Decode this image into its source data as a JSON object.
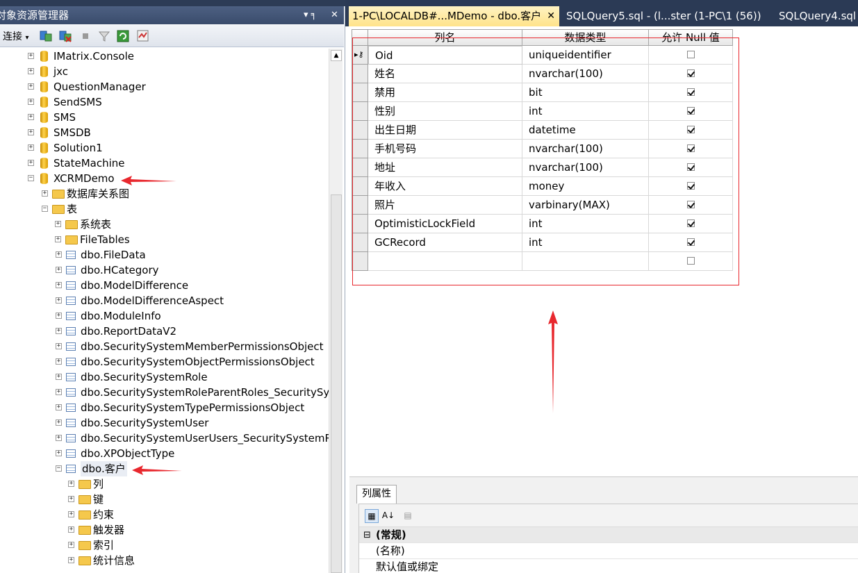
{
  "object_explorer": {
    "title": "对象资源管理器",
    "pin_glyph": "▾ ╕",
    "close_glyph": "✕",
    "connect_label": "连接",
    "connect_caret": "▾",
    "tree": [
      {
        "label": "IMatrix.Console",
        "kind": "database",
        "expander": "+"
      },
      {
        "label": "jxc",
        "kind": "database",
        "expander": "+"
      },
      {
        "label": "QuestionManager",
        "kind": "database",
        "expander": "+"
      },
      {
        "label": "SendSMS",
        "kind": "database",
        "expander": "+"
      },
      {
        "label": "SMS",
        "kind": "database",
        "expander": "+"
      },
      {
        "label": "SMSDB",
        "kind": "database",
        "expander": "+"
      },
      {
        "label": "Solution1",
        "kind": "database",
        "expander": "+"
      },
      {
        "label": "StateMachine",
        "kind": "database",
        "expander": "+"
      },
      {
        "label": "XCRMDemo",
        "kind": "database",
        "expander": "−"
      },
      {
        "label": "数据库关系图",
        "kind": "folder",
        "expander": "+"
      },
      {
        "label": "表",
        "kind": "folder",
        "expander": "−"
      },
      {
        "label": "系统表",
        "kind": "folder",
        "expander": "+"
      },
      {
        "label": "FileTables",
        "kind": "folder",
        "expander": "+"
      },
      {
        "label": "dbo.FileData",
        "kind": "table",
        "expander": "+"
      },
      {
        "label": "dbo.HCategory",
        "kind": "table",
        "expander": "+"
      },
      {
        "label": "dbo.ModelDifference",
        "kind": "table",
        "expander": "+"
      },
      {
        "label": "dbo.ModelDifferenceAspect",
        "kind": "table",
        "expander": "+"
      },
      {
        "label": "dbo.ModuleInfo",
        "kind": "table",
        "expander": "+"
      },
      {
        "label": "dbo.ReportDataV2",
        "kind": "table",
        "expander": "+"
      },
      {
        "label": "dbo.SecuritySystemMemberPermissionsObject",
        "kind": "table",
        "expander": "+"
      },
      {
        "label": "dbo.SecuritySystemObjectPermissionsObject",
        "kind": "table",
        "expander": "+"
      },
      {
        "label": "dbo.SecuritySystemRole",
        "kind": "table",
        "expander": "+"
      },
      {
        "label": "dbo.SecuritySystemRoleParentRoles_SecuritySys",
        "kind": "table",
        "expander": "+"
      },
      {
        "label": "dbo.SecuritySystemTypePermissionsObject",
        "kind": "table",
        "expander": "+"
      },
      {
        "label": "dbo.SecuritySystemUser",
        "kind": "table",
        "expander": "+"
      },
      {
        "label": "dbo.SecuritySystemUserUsers_SecuritySystemRo",
        "kind": "table",
        "expander": "+"
      },
      {
        "label": "dbo.XPObjectType",
        "kind": "table",
        "expander": "+"
      },
      {
        "label": "dbo.客户",
        "kind": "table",
        "expander": "−"
      },
      {
        "label": "列",
        "kind": "folder",
        "expander": "+"
      },
      {
        "label": "键",
        "kind": "folder",
        "expander": "+"
      },
      {
        "label": "约束",
        "kind": "folder",
        "expander": "+"
      },
      {
        "label": "触发器",
        "kind": "folder",
        "expander": "+"
      },
      {
        "label": "索引",
        "kind": "folder",
        "expander": "+"
      },
      {
        "label": "统计信息",
        "kind": "folder",
        "expander": "+"
      }
    ]
  },
  "tabs": [
    {
      "label": "1-PC\\LOCALDB#...MDemo - dbo.客户",
      "close": "✕"
    },
    {
      "label": "SQLQuery5.sql - (l...ster (1-PC\\1 (56))"
    },
    {
      "label": "SQLQuery4.sql -"
    }
  ],
  "designer": {
    "headers": {
      "name": "列名",
      "type": "数据类型",
      "null": "允许 Null 值"
    },
    "rows": [
      {
        "name": "Oid",
        "type": "uniqueidentifier",
        "allow_null": false,
        "key": true
      },
      {
        "name": "姓名",
        "type": "nvarchar(100)",
        "allow_null": true
      },
      {
        "name": "禁用",
        "type": "bit",
        "allow_null": true
      },
      {
        "name": "性别",
        "type": "int",
        "allow_null": true
      },
      {
        "name": "出生日期",
        "type": "datetime",
        "allow_null": true
      },
      {
        "name": "手机号码",
        "type": "nvarchar(100)",
        "allow_null": true
      },
      {
        "name": "地址",
        "type": "nvarchar(100)",
        "allow_null": true
      },
      {
        "name": "年收入",
        "type": "money",
        "allow_null": true
      },
      {
        "name": "照片",
        "type": "varbinary(MAX)",
        "allow_null": true
      },
      {
        "name": "OptimisticLockField",
        "type": "int",
        "allow_null": true
      },
      {
        "name": "GCRecord",
        "type": "int",
        "allow_null": true
      },
      {
        "name": "",
        "type": "",
        "allow_null": false
      }
    ]
  },
  "properties": {
    "tab_label": "列属性",
    "category": "(常规)",
    "category_expander": "⊟",
    "rows": [
      "(名称)",
      "默认值或绑定"
    ]
  },
  "colors": {
    "accent_red": "#e8282e",
    "title_bar": "#3a4c6c",
    "active_tab": "#ffe38a"
  }
}
